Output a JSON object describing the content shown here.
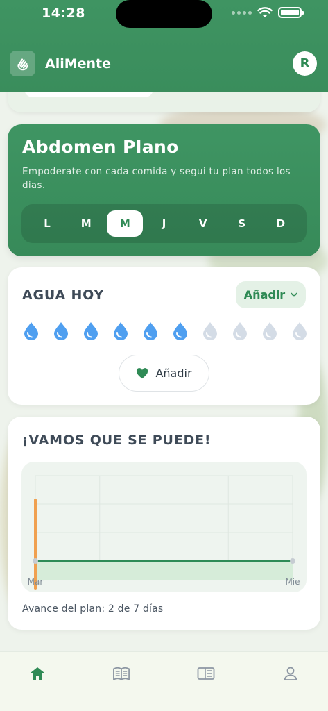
{
  "status_bar": {
    "time": "14:28"
  },
  "header": {
    "app_name": "AliMente",
    "avatar_initial": "R",
    "logo_icon": "hand-wave-icon"
  },
  "plan": {
    "title": "Abdomen Plano",
    "subtitle": "Empoderate con cada comida y segui tu plan todos los dias.",
    "days": [
      "L",
      "M",
      "M",
      "J",
      "V",
      "S",
      "D"
    ],
    "active_day_index": 2
  },
  "water": {
    "title": "AGUA HOY",
    "select_label": "Añadir",
    "total_drops": 10,
    "filled_drops": 6,
    "add_button_label": "Añadir",
    "colors": {
      "filled": "#4f9ff0",
      "empty": "#d4dce6"
    }
  },
  "progress": {
    "title": "¡VAMOS QUE SE PUEDE!",
    "summary": "Avance del plan: 2 de 7 días"
  },
  "chart_data": {
    "type": "line",
    "categories": [
      "Mar",
      "Mie"
    ],
    "series": [
      {
        "values": [
          0,
          0
        ],
        "color": "#2e8b57"
      }
    ],
    "highlight_category": "Mar",
    "highlight_color": "#f0a050",
    "grid": true
  },
  "tabs": [
    {
      "icon": "home-icon",
      "active": true
    },
    {
      "icon": "book-icon",
      "active": false
    },
    {
      "icon": "newspaper-icon",
      "active": false
    },
    {
      "icon": "user-icon",
      "active": false
    }
  ],
  "accent_color": "#3a8d5c"
}
